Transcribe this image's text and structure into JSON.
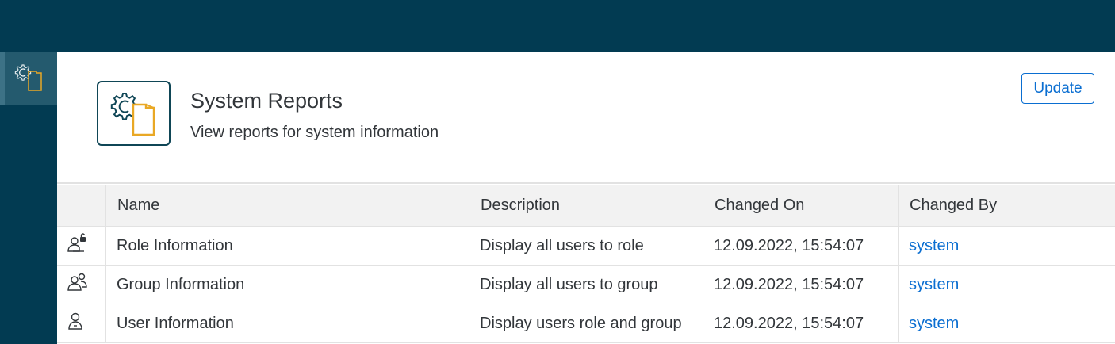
{
  "shell": {
    "sidebar": {
      "items": [
        {
          "icon": "system-reports-icon",
          "selected": true
        }
      ]
    }
  },
  "page": {
    "title": "System Reports",
    "subtitle": "View reports for system information",
    "icon": "system-reports-icon",
    "update_label": "Update"
  },
  "table": {
    "columns": [
      "",
      "Name",
      "Description",
      "Changed On",
      "Changed By"
    ],
    "rows": [
      {
        "icon": "role-lock-icon",
        "name": "Role Information",
        "description": "Display all users to role",
        "changed_on": "12.09.2022, 15:54:07",
        "changed_by": "system"
      },
      {
        "icon": "group-icon",
        "name": "Group Information",
        "description": "Display all users to group",
        "changed_on": "12.09.2022, 15:54:07",
        "changed_by": "system"
      },
      {
        "icon": "user-icon",
        "name": "User Information",
        "description": "Display users role and group",
        "changed_on": "12.09.2022, 15:54:07",
        "changed_by": "system"
      }
    ]
  },
  "colors": {
    "shell": "#023b52",
    "accent": "#0a6ed1",
    "icon_yellow": "#e9a825"
  }
}
